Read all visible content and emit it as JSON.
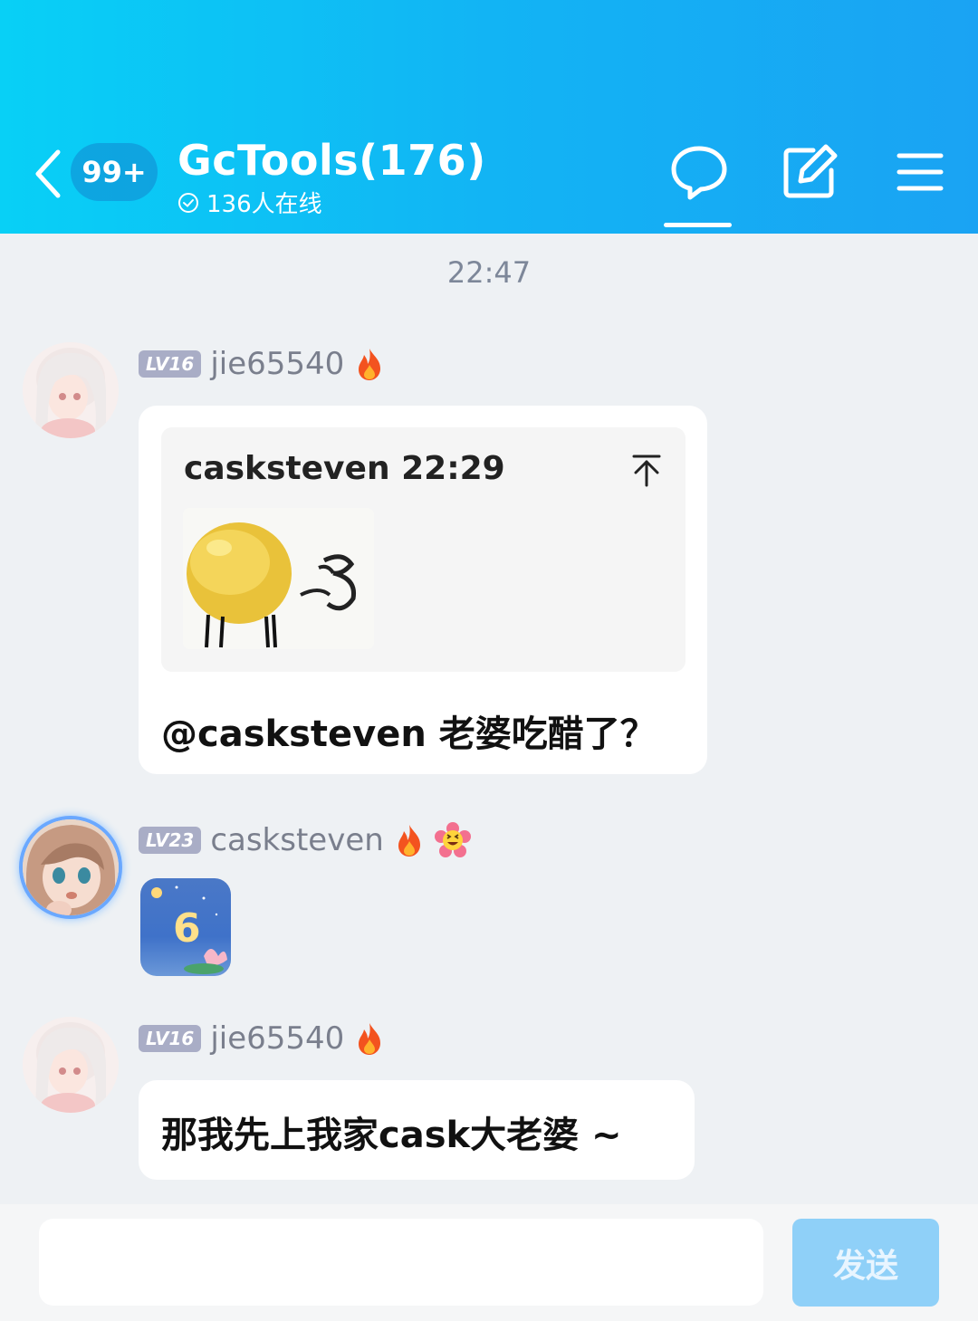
{
  "header": {
    "unread_badge": "99+",
    "group_title": "GcTools(176)",
    "online_status": "136人在线"
  },
  "timestamp": "22:47",
  "messages": [
    {
      "level": "LV16",
      "username": "jie65540",
      "quote": {
        "header": "casksteven 22:29"
      },
      "text": "@casksteven 老婆吃醋了？"
    },
    {
      "level": "LV23",
      "username": "casksteven",
      "sticker_text": "6"
    },
    {
      "level": "LV16",
      "username": "jie65540",
      "text": "那我先上我家cask大老婆 ~"
    }
  ],
  "input": {
    "placeholder": ""
  },
  "send_label": "发送",
  "colors": {
    "header_gradient_start": "#08d0f6",
    "header_gradient_end": "#1aa3f3",
    "level_badge": "#a9adc6",
    "send_button": "#8fd0f8",
    "background": "#eef1f4"
  }
}
